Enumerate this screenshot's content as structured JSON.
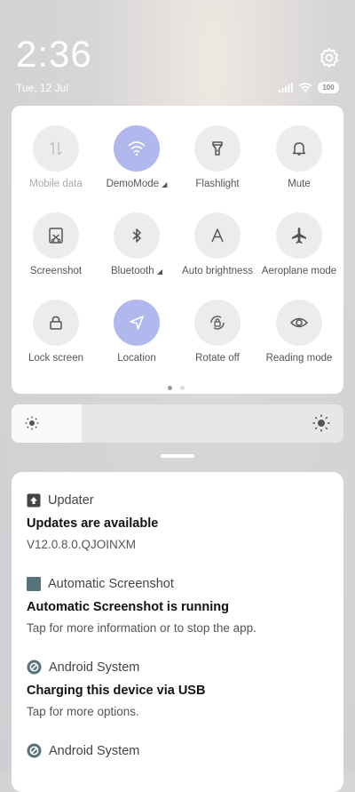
{
  "status_bar": {
    "time": "2:36",
    "date": "Tue, 12 Jul",
    "battery": "100",
    "icons": [
      "signal-icon",
      "wifi-icon",
      "battery-icon"
    ]
  },
  "settings_icon": "gear-icon",
  "quick_settings": {
    "tiles": [
      {
        "label": "Mobile data",
        "icon": "mobile-data-icon",
        "active": false,
        "disabled": true
      },
      {
        "label": "DemoMode",
        "icon": "wifi-icon",
        "active": true,
        "expandable": true
      },
      {
        "label": "Flashlight",
        "icon": "flashlight-icon",
        "active": false
      },
      {
        "label": "Mute",
        "icon": "bell-icon",
        "active": false
      },
      {
        "label": "Screenshot",
        "icon": "screenshot-icon",
        "active": false
      },
      {
        "label": "Bluetooth",
        "icon": "bluetooth-icon",
        "active": false,
        "expandable": true
      },
      {
        "label": "Auto brightness",
        "icon": "auto-brightness-icon",
        "active": false
      },
      {
        "label": "Aeroplane mode",
        "icon": "airplane-icon",
        "active": false
      },
      {
        "label": "Lock screen",
        "icon": "lock-icon",
        "active": false
      },
      {
        "label": "Location",
        "icon": "location-icon",
        "active": true
      },
      {
        "label": "Rotate off",
        "icon": "rotate-lock-icon",
        "active": false
      },
      {
        "label": "Reading mode",
        "icon": "eye-icon",
        "active": false
      }
    ],
    "page_count": 2,
    "current_page": 1
  },
  "brightness": {
    "level": 0.21
  },
  "notifications": [
    {
      "app": "Updater",
      "icon": "updater-icon",
      "title": "Updates are available",
      "text": "V12.0.8.0.QJOINXM"
    },
    {
      "app": "Automatic Screenshot",
      "icon": "app-square-icon",
      "title": "Automatic Screenshot is running",
      "text": "Tap for more information or to stop the app."
    },
    {
      "app": "Android System",
      "icon": "android-system-icon",
      "title": "Charging this device via USB",
      "text": "Tap for more options."
    },
    {
      "app": "Android System",
      "icon": "android-system-icon",
      "title": "",
      "text": ""
    }
  ],
  "colors": {
    "accent_active": "#b1b8ee",
    "tile_inactive": "#ececec"
  }
}
